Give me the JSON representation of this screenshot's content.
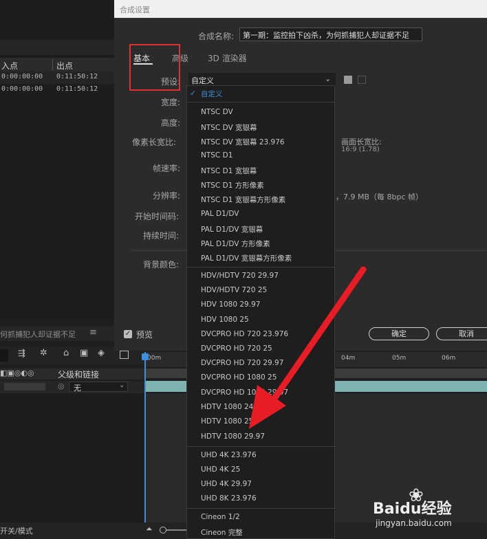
{
  "dialog": {
    "title": "合成设置",
    "comp_name_label": "合成名称:",
    "comp_name_value": "第一期：监控拍下凶杀，为何抓捕犯人却证据不足",
    "tabs": [
      "基本",
      "高级",
      "3D 渲染器"
    ],
    "preset_label": "预设:",
    "preset_value": "自定义",
    "width_label": "宽度:",
    "height_label": "高度:",
    "pixel_aspect_label": "像素长宽比:",
    "frame_aspect_label": "画面长宽比:",
    "frame_aspect_value": "16:9 (1.78)",
    "frame_rate_label": "帧速率:",
    "resolution_label": "分辨率:",
    "resolution_info": "，7.9 MB（每 8bpc 帧）",
    "start_tc_label": "开始时间码:",
    "duration_label": "持续时间:",
    "bg_color_label": "背景颜色:",
    "preview_label": "预览",
    "ok_label": "确定",
    "cancel_label": "取消"
  },
  "dropdown": {
    "items": [
      "自定义",
      "NTSC DV",
      "NTSC DV 宽银幕",
      "NTSC DV 宽银幕 23.976",
      "NTSC D1",
      "NTSC D1 宽银幕",
      "NTSC D1 方形像素",
      "NTSC D1 宽银幕方形像素",
      "PAL D1/DV",
      "PAL D1/DV 宽银幕",
      "PAL D1/DV 方形像素",
      "PAL D1/DV 宽银幕方形像素",
      "HDV/HDTV 720 29.97",
      "HDV/HDTV 720 25",
      "HDV 1080 29.97",
      "HDV 1080 25",
      "DVCPRO HD 720 23.976",
      "DVCPRO HD 720 25",
      "DVCPRO HD 720 29.97",
      "DVCPRO HD 1080 25",
      "DVCPRO HD 1080 29.97",
      "HDTV 1080 24",
      "HDTV 1080 25",
      "HDTV 1080 29.97",
      "UHD 4K 23.976",
      "UHD 4K 25",
      "UHD 4K 29.97",
      "UHD 8K 23.976",
      "Cineon 1/2",
      "Cineon 完整"
    ]
  },
  "left_panel": {
    "col_in": "入点",
    "col_out": "出点",
    "row1_in": "0:00:00:00",
    "row1_out": "0:11:50:12",
    "row2_in": "0:00:00:00",
    "row2_out": "0:11:50:12",
    "comp_tab": "何抓捕犯人却证据不足",
    "parent_label": "父级和链接",
    "parent_value": "无",
    "toggle_label": "开关/模式"
  },
  "timeline": {
    "ticks": [
      "00m",
      "04m",
      "05m",
      "06m"
    ]
  },
  "watermark": {
    "brand": "Baidu经验",
    "url": "jingyan.baidu.com"
  },
  "colors": {
    "highlight_box": "#e0322d",
    "arrow": "#e81c24",
    "accent_blue": "#3d8fe0",
    "track_teal": "#7fb3b0"
  }
}
